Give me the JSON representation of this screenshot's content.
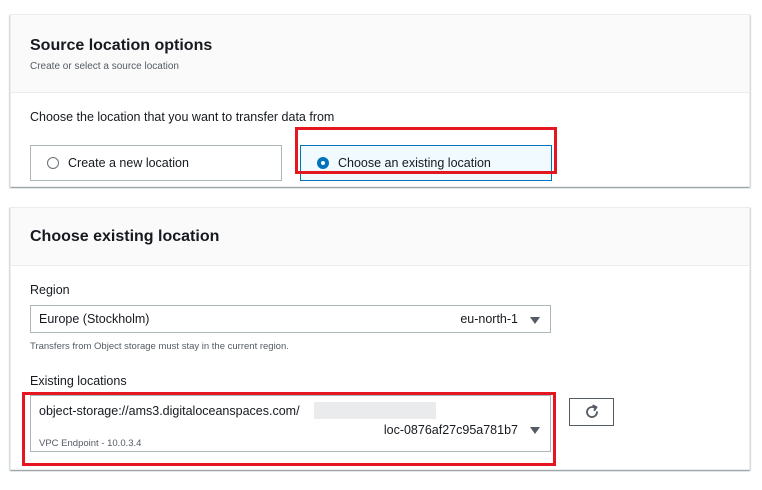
{
  "source_panel": {
    "title": "Source location options",
    "description": "Create or select a source location",
    "question": "Choose the location that you want to transfer data from",
    "options": [
      {
        "label": "Create a new location",
        "selected": false
      },
      {
        "label": "Choose an existing location",
        "selected": true
      }
    ]
  },
  "existing_panel": {
    "title": "Choose existing location",
    "region": {
      "label": "Region",
      "name": "Europe (Stockholm)",
      "code": "eu-north-1",
      "hint": "Transfers from Object storage must stay in the current region."
    },
    "locations": {
      "label": "Existing locations",
      "uri": "object-storage://ams3.digitaloceanspaces.com/",
      "id": "loc-0876af27c95a781b7",
      "endpoint": "VPC Endpoint - 10.0.3.4"
    },
    "refresh_icon": "refresh-icon"
  },
  "colors": {
    "accent": "#0073bb",
    "highlight": "#e4161f",
    "selected_bg": "#f1faff"
  }
}
